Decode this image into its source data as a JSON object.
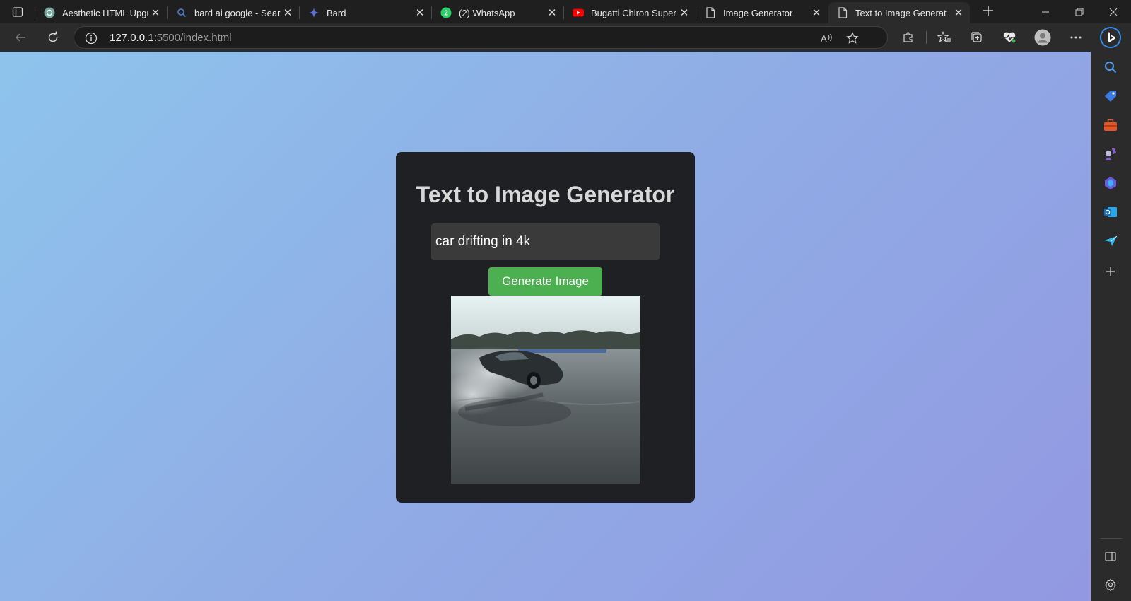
{
  "tabs": [
    {
      "title": "Aesthetic HTML Upgra",
      "favicon": "chatgpt-icon"
    },
    {
      "title": "bard ai google - Searc",
      "favicon": "search-icon"
    },
    {
      "title": "Bard",
      "favicon": "bard-sparkle-icon"
    },
    {
      "title": "(2) WhatsApp",
      "favicon": "whatsapp-icon",
      "badge": "2"
    },
    {
      "title": "Bugatti Chiron Super S",
      "favicon": "youtube-icon"
    },
    {
      "title": "Image Generator",
      "favicon": "page-icon"
    },
    {
      "title": "Text to Image Generat",
      "favicon": "page-icon",
      "active": true
    }
  ],
  "address": {
    "host": "127.0.0.1",
    "rest": ":5500/index.html"
  },
  "page": {
    "heading": "Text to Image Generator",
    "prompt_value": "car drifting in 4k",
    "button_label": "Generate Image"
  },
  "colors": {
    "button": "#4caf50",
    "card": "#1f2023",
    "gradient_start": "#8ec4ec",
    "gradient_end": "#9298e1"
  },
  "sidebar_icons": [
    "search-icon",
    "tag-icon",
    "toolbox-icon",
    "games-icon",
    "copilot-icon",
    "outlook-icon",
    "send-icon",
    "add-icon",
    "sidebar-toggle-icon",
    "settings-icon"
  ]
}
